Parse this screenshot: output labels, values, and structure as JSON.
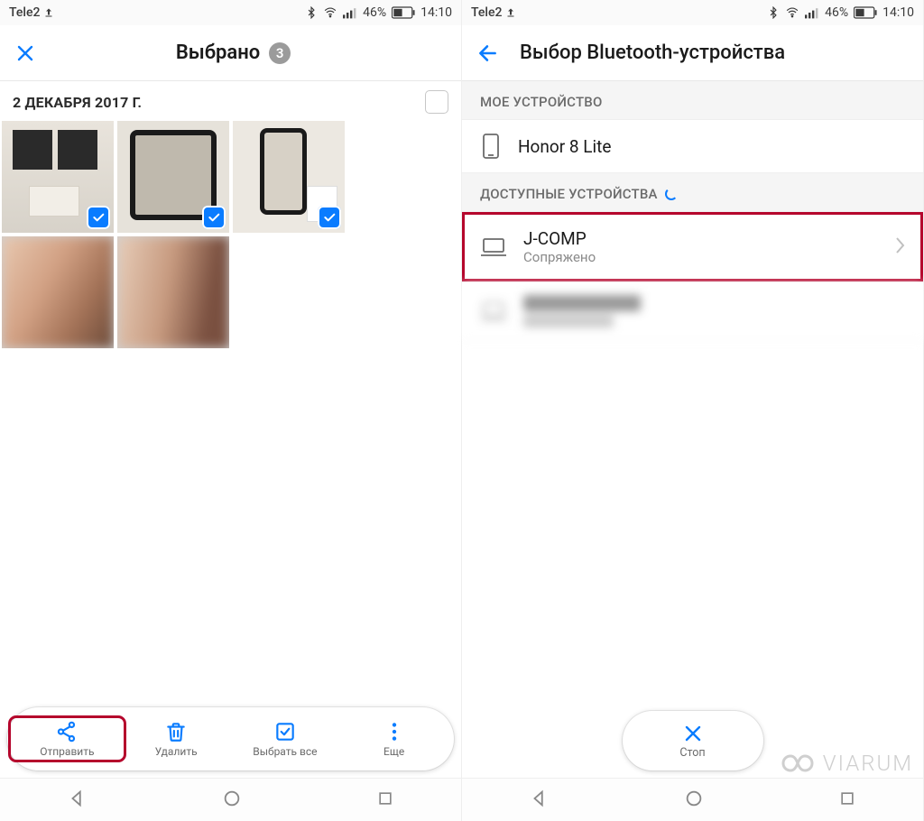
{
  "statusbar": {
    "carrier": "Tele2",
    "battery_pct": "46%",
    "time": "14:10"
  },
  "left": {
    "title": "Выбрано",
    "selected_count": "3",
    "date_label": "2 ДЕКАБРЯ 2017 Г.",
    "actions": {
      "send": "Отправить",
      "delete": "Удалить",
      "select_all": "Выбрать все",
      "more": "Еще"
    }
  },
  "right": {
    "title": "Выбор Bluetooth-устройства",
    "my_device_section": "МОЕ УСТРОЙСТВО",
    "my_device_name": "Honor 8 Lite",
    "available_section": "ДОСТУПНЫЕ УСТРОЙСТВА",
    "devices": [
      {
        "name": "J-COMP",
        "status": "Сопряжено"
      }
    ],
    "stop_label": "Стоп"
  },
  "watermark": "VIARUM"
}
